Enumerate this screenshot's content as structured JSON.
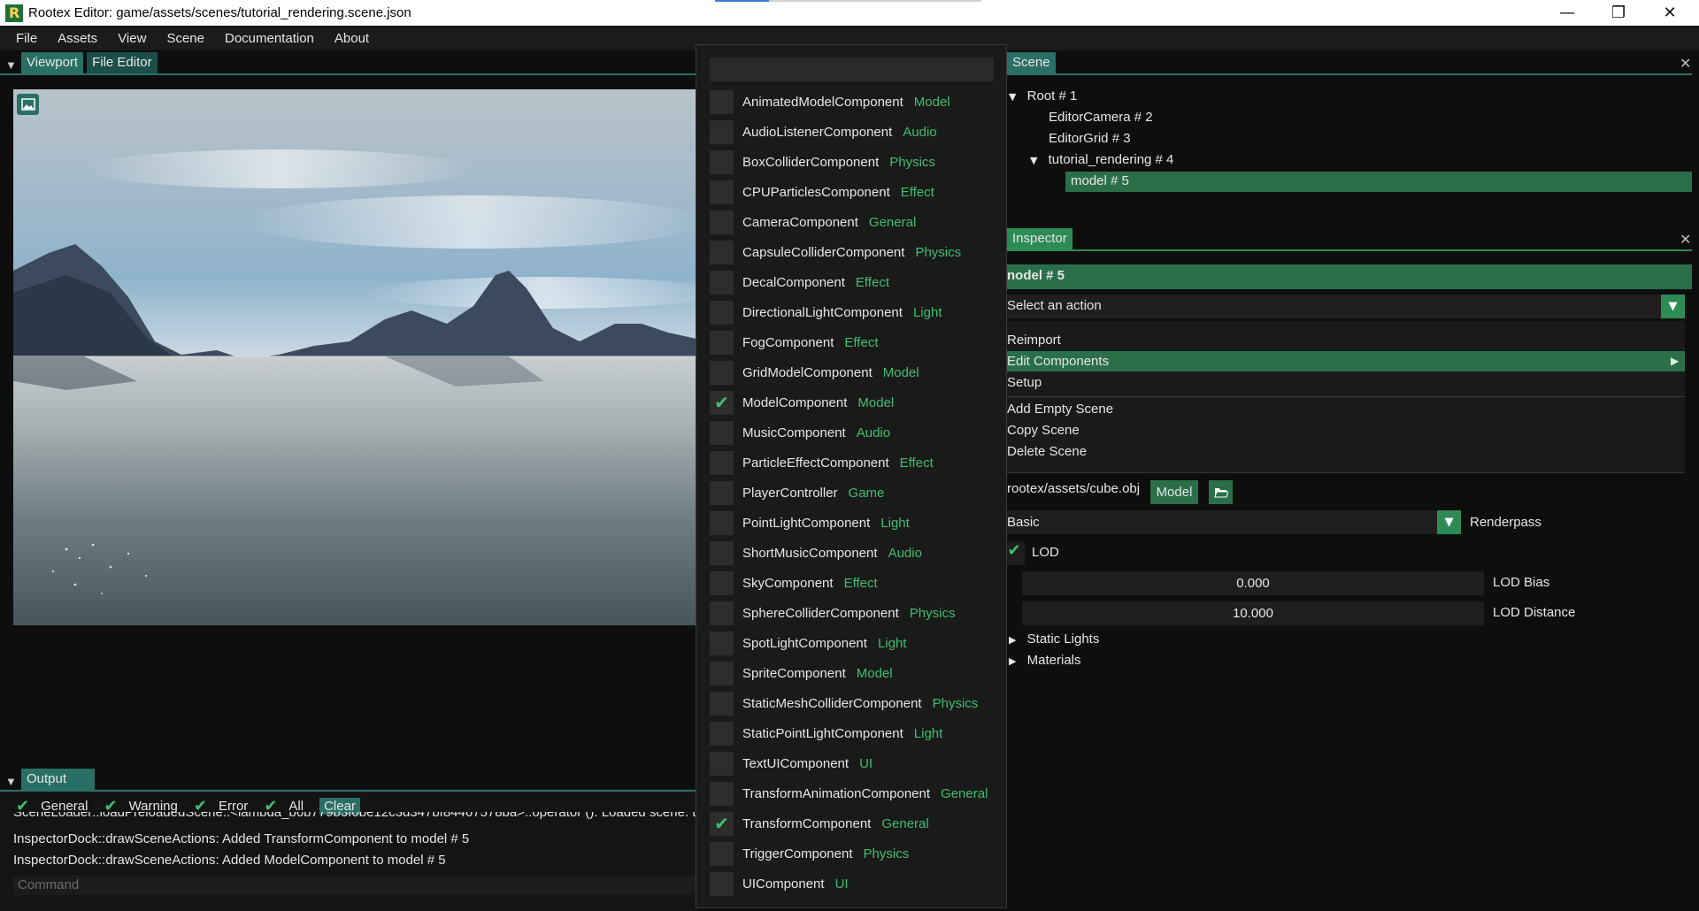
{
  "window": {
    "title": "Rootex Editor: game/assets/scenes/tutorial_rendering.scene.json",
    "minimize": "—",
    "restore": "❐",
    "close": "✕"
  },
  "menu": [
    "File",
    "Assets",
    "View",
    "Scene",
    "Documentation",
    "About"
  ],
  "left_tabs": [
    "Viewport",
    "File Editor"
  ],
  "output": {
    "tab": "Output",
    "filters": [
      "General",
      "Warning",
      "Error",
      "All"
    ],
    "clear": "Clear",
    "logs": [
      "SceneLoader::loadPreloadedScene::<lambda_b6b779b3f0be12c3d347bf84467578ba>::operator (): Loaded scene: tu",
      "InspectorDock::drawSceneActions: Added TransformComponent to model # 5",
      "InspectorDock::drawSceneActions: Added ModelComponent to model # 5"
    ],
    "command_placeholder": "Command"
  },
  "components": [
    {
      "name": "AnimatedModelComponent",
      "category": "Model",
      "checked": false
    },
    {
      "name": "AudioListenerComponent",
      "category": "Audio",
      "checked": false
    },
    {
      "name": "BoxColliderComponent",
      "category": "Physics",
      "checked": false
    },
    {
      "name": "CPUParticlesComponent",
      "category": "Effect",
      "checked": false
    },
    {
      "name": "CameraComponent",
      "category": "General",
      "checked": false
    },
    {
      "name": "CapsuleColliderComponent",
      "category": "Physics",
      "checked": false
    },
    {
      "name": "DecalComponent",
      "category": "Effect",
      "checked": false
    },
    {
      "name": "DirectionalLightComponent",
      "category": "Light",
      "checked": false
    },
    {
      "name": "FogComponent",
      "category": "Effect",
      "checked": false
    },
    {
      "name": "GridModelComponent",
      "category": "Model",
      "checked": false
    },
    {
      "name": "ModelComponent",
      "category": "Model",
      "checked": true
    },
    {
      "name": "MusicComponent",
      "category": "Audio",
      "checked": false
    },
    {
      "name": "ParticleEffectComponent",
      "category": "Effect",
      "checked": false
    },
    {
      "name": "PlayerController",
      "category": "Game",
      "checked": false
    },
    {
      "name": "PointLightComponent",
      "category": "Light",
      "checked": false
    },
    {
      "name": "ShortMusicComponent",
      "category": "Audio",
      "checked": false
    },
    {
      "name": "SkyComponent",
      "category": "Effect",
      "checked": false
    },
    {
      "name": "SphereColliderComponent",
      "category": "Physics",
      "checked": false
    },
    {
      "name": "SpotLightComponent",
      "category": "Light",
      "checked": false
    },
    {
      "name": "SpriteComponent",
      "category": "Model",
      "checked": false
    },
    {
      "name": "StaticMeshColliderComponent",
      "category": "Physics",
      "checked": false
    },
    {
      "name": "StaticPointLightComponent",
      "category": "Light",
      "checked": false
    },
    {
      "name": "TextUIComponent",
      "category": "UI",
      "checked": false
    },
    {
      "name": "TransformAnimationComponent",
      "category": "General",
      "checked": false
    },
    {
      "name": "TransformComponent",
      "category": "General",
      "checked": true
    },
    {
      "name": "TriggerComponent",
      "category": "Physics",
      "checked": false
    },
    {
      "name": "UIComponent",
      "category": "UI",
      "checked": false
    }
  ],
  "scene": {
    "tab": "Scene",
    "tree": [
      "Root # 1",
      "EditorCamera # 2",
      "EditorGrid # 3",
      "tutorial_rendering # 4",
      "model # 5"
    ]
  },
  "inspector": {
    "tab": "Inspector",
    "entity": "nodel # 5",
    "action_placeholder": "Select an action",
    "actions": [
      "Reimport",
      "Edit Components",
      "Setup",
      "Add Empty Scene",
      "Copy Scene",
      "Delete Scene"
    ],
    "model_path": "rootex/assets/cube.obj",
    "model_button": "Model",
    "renderpass_value": "Basic",
    "renderpass_label": "Renderpass",
    "lod_label": "LOD",
    "lod_bias_value": "0.000",
    "lod_bias_label": "LOD Bias",
    "lod_distance_value": "10.000",
    "lod_distance_label": "LOD Distance",
    "static_lights": "Static Lights",
    "materials": "Materials"
  },
  "colors": {
    "accent_green": "#3fbf6f",
    "tab_teal": "#2a6f66",
    "selection_green": "#2a6f4a"
  }
}
